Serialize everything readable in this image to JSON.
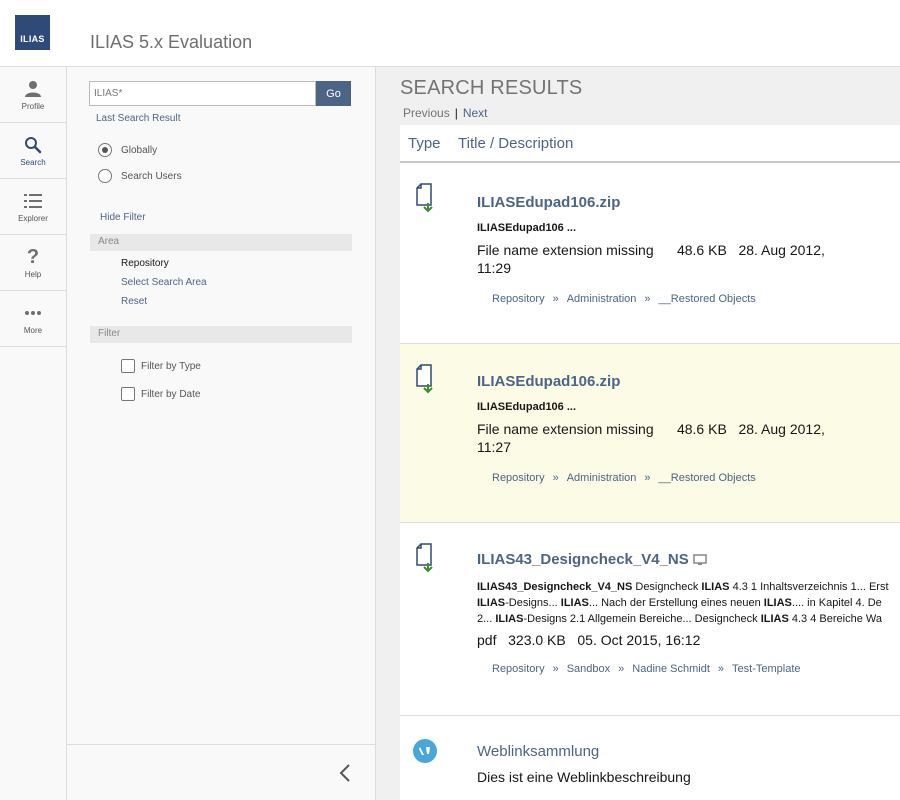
{
  "header": {
    "logo_text": "ILIAS",
    "title": "ILIAS 5.x Evaluation"
  },
  "mainbar": {
    "items": [
      {
        "label": "Profile",
        "icon": "person-icon"
      },
      {
        "label": "Search",
        "icon": "search-icon"
      },
      {
        "label": "Explorer",
        "icon": "list-icon"
      },
      {
        "label": "Help",
        "icon": "question-icon"
      },
      {
        "label": "More",
        "icon": "ellipsis-icon"
      }
    ]
  },
  "slate": {
    "search_placeholder": "ILIAS*",
    "go_label": "Go",
    "last_result": "Last Search Result",
    "radio_globally": "Globally",
    "radio_users": "Search Users",
    "hide_filter": "Hide Filter",
    "area_heading": "Area",
    "area_value": "Repository",
    "select_area": "Select Search Area",
    "reset": "Reset",
    "filter_heading": "Filter",
    "filter_type": "Filter by Type",
    "filter_date": "Filter by Date"
  },
  "results": {
    "title": "SEARCH RESULTS",
    "prev": "Previous",
    "sep": "|",
    "next": "Next",
    "col_type": "Type",
    "col_title": "Title / Description",
    "path_sep": "»",
    "rows": [
      {
        "title": "ILIASEdupad106.zip",
        "desc": "ILIASEdupad106 ...",
        "props_line1": "File name extension missing      48.6 KB   28. Aug 2012,",
        "props_line2": "11:29",
        "path": [
          "Repository",
          "Administration",
          "__Restored Objects"
        ]
      },
      {
        "title": "ILIASEdupad106.zip",
        "desc": "ILIASEdupad106 ...",
        "props_line1": "File name extension missing      48.6 KB   28. Aug 2012,",
        "props_line2": "11:27",
        "path": [
          "Repository",
          "Administration",
          "__Restored Objects"
        ]
      },
      {
        "title": "ILIAS43_Designcheck_V4_NS",
        "desc_line1_a": "ILIAS43_Designcheck_V4_NS",
        "desc_line1_b": " Designcheck ",
        "desc_line1_c": "ILIAS",
        "desc_line1_d": " 4.3 1 Inhaltsverzeichnis 1... Erst",
        "desc_line2_a": "ILIAS",
        "desc_line2_b": "-Designs... ",
        "desc_line2_c": "ILIAS",
        "desc_line2_d": "... Nach der Erstellung eines neuen ",
        "desc_line2_e": "ILIAS",
        "desc_line2_f": ".... in Kapitel 4. De",
        "desc_line3_a": "2... ",
        "desc_line3_b": "ILIAS",
        "desc_line3_c": "-Designs 2.1 Allgemein Bereiche... Designcheck ",
        "desc_line3_d": "ILIAS",
        "desc_line3_e": " 4.3 4 Bereiche Wa",
        "props": "pdf   323.0 KB   05. Oct 2015, 16:12",
        "path": [
          "Repository",
          "Sandbox",
          "Nadine Schmidt",
          "Test-Template"
        ]
      },
      {
        "title": "Weblinksammlung",
        "desc": "Dies ist eine Weblinkbeschreibung"
      }
    ]
  },
  "colors": {
    "accent": "#4c6586",
    "brand": "#2c4b78",
    "highlight": "#fcfbe6"
  }
}
